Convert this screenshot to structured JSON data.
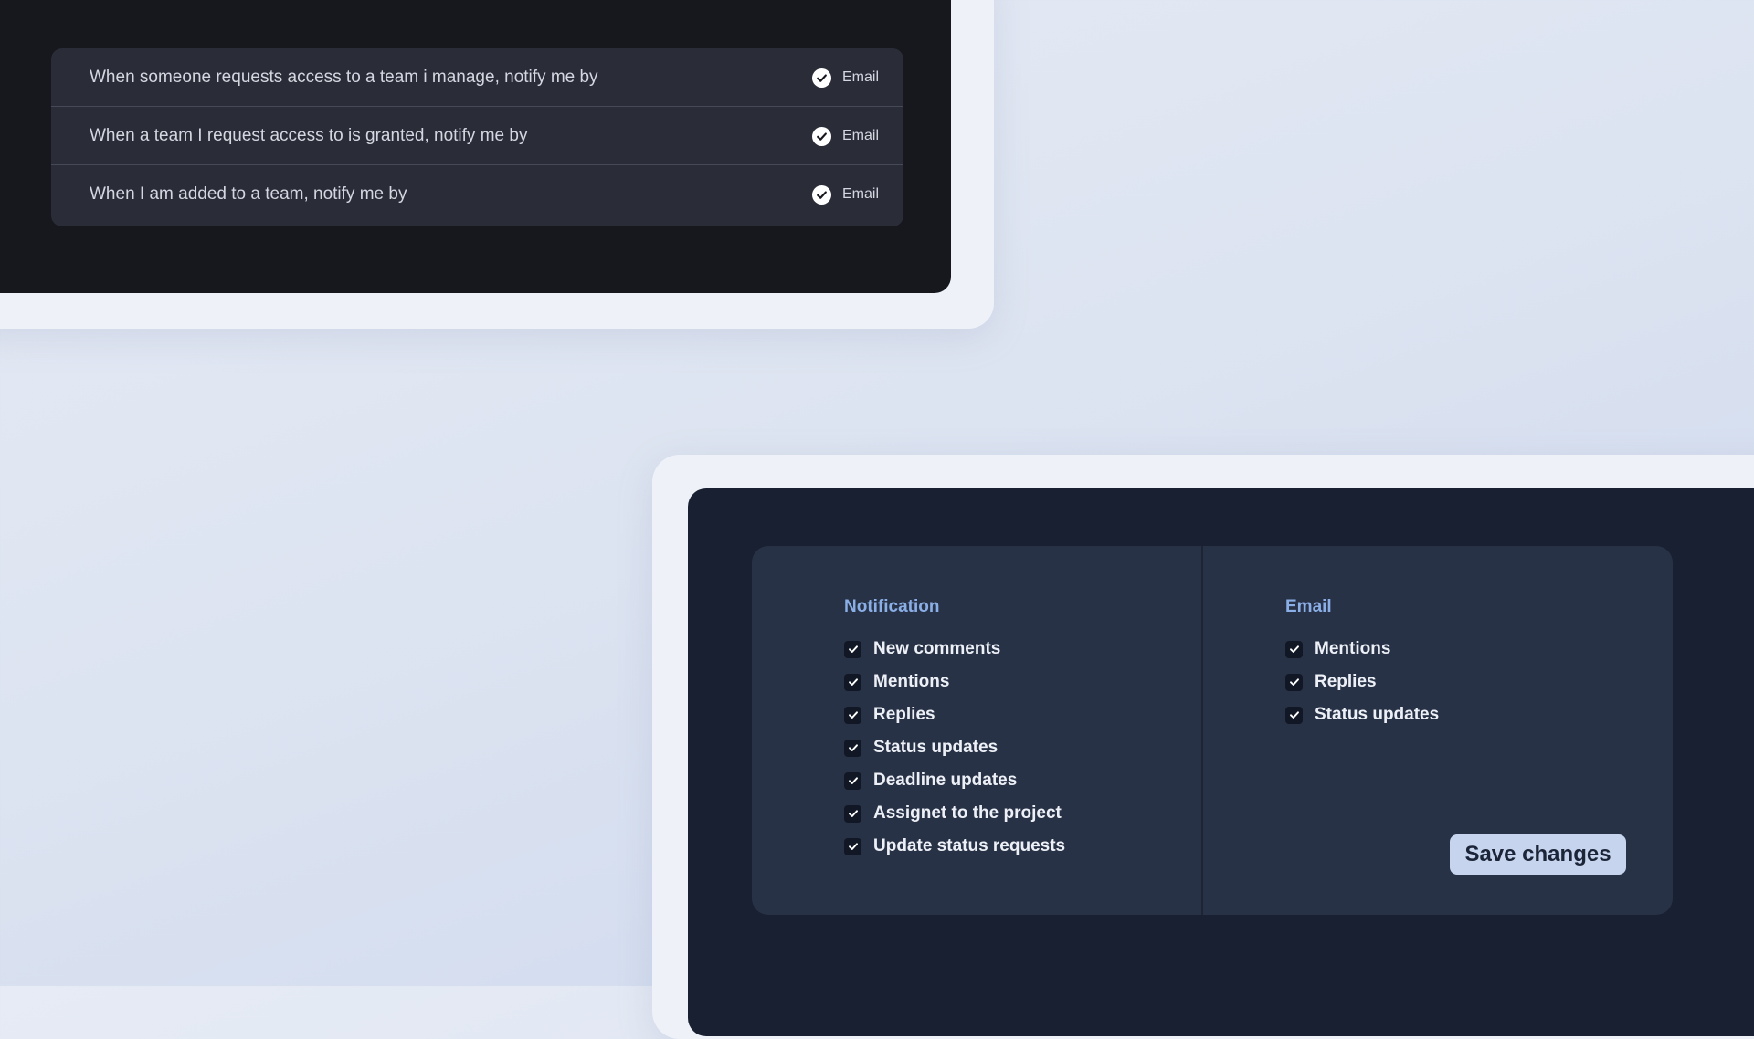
{
  "team_notifications": {
    "rows": [
      {
        "text": "When someone requests access to a team i manage, notify me by",
        "option": "Email",
        "checked": true
      },
      {
        "text": "When a team I request access to is granted, notify me by",
        "option": "Email",
        "checked": true
      },
      {
        "text": "When I am added to a team, notify me by",
        "option": "Email",
        "checked": true
      }
    ]
  },
  "settings": {
    "notification": {
      "heading": "Notification",
      "items": [
        "New comments",
        "Mentions",
        "Replies",
        "Status updates",
        "Deadline updates",
        "Assignet to the project",
        "Update status requests"
      ]
    },
    "email": {
      "heading": "Email",
      "items": [
        "Mentions",
        "Replies",
        "Status updates"
      ]
    },
    "save_label": "Save changes"
  },
  "icons": {
    "check": "check-icon"
  },
  "colors": {
    "accent": "#8aaee6",
    "button_bg": "#c6d4ee",
    "dark_panel": "#17181e",
    "navy_panel": "#182031"
  }
}
